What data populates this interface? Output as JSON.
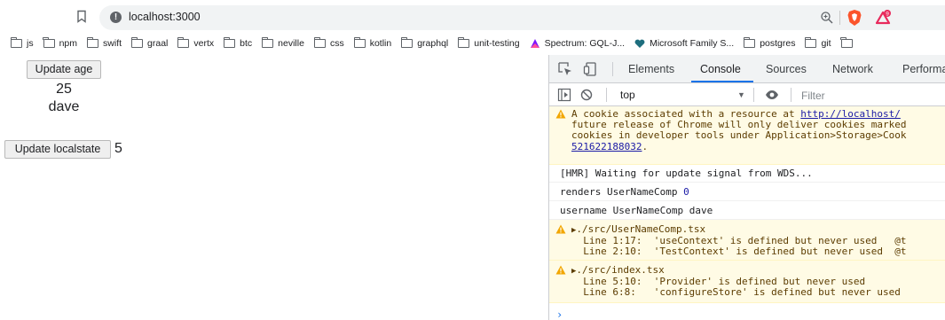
{
  "browser": {
    "url": "localhost:3000",
    "bookmarks": [
      {
        "label": "js",
        "icon": "folder-icon"
      },
      {
        "label": "npm",
        "icon": "folder-icon"
      },
      {
        "label": "swift",
        "icon": "folder-icon"
      },
      {
        "label": "graal",
        "icon": "folder-icon"
      },
      {
        "label": "vertx",
        "icon": "folder-icon"
      },
      {
        "label": "btc",
        "icon": "folder-icon"
      },
      {
        "label": "neville",
        "icon": "folder-icon"
      },
      {
        "label": "css",
        "icon": "folder-icon"
      },
      {
        "label": "kotlin",
        "icon": "folder-icon"
      },
      {
        "label": "graphql",
        "icon": "folder-icon"
      },
      {
        "label": "unit-testing",
        "icon": "folder-icon"
      },
      {
        "label": "Spectrum: GQL-J...",
        "icon": "spectrum-icon"
      },
      {
        "label": "Microsoft Family S...",
        "icon": "heart-icon"
      },
      {
        "label": "postgres",
        "icon": "folder-icon"
      },
      {
        "label": "git",
        "icon": "folder-icon"
      },
      {
        "label": "",
        "icon": "folder-icon"
      }
    ]
  },
  "app": {
    "update_age_label": "Update age",
    "age": "25",
    "name": "dave",
    "update_localstate_label": "Update localstate",
    "localstate": "5"
  },
  "devtools": {
    "tabs": [
      "Elements",
      "Console",
      "Sources",
      "Network",
      "Performa"
    ],
    "active_tab": "Console",
    "context": "top",
    "filter_placeholder": "Filter",
    "messages": {
      "cookie_line1a": "A cookie associated with a resource at ",
      "cookie_link": "http://localhost/",
      "cookie_line2": "future release of Chrome will only deliver cookies marked",
      "cookie_line3": "cookies in developer tools under Application>Storage>Cook",
      "cookie_line4": "521622188032",
      "cookie_line4_end": ".",
      "hmr": "[HMR] Waiting for update signal from WDS...",
      "renders_text": "renders UserNameComp ",
      "renders_count": "0",
      "username": "username UserNameComp dave",
      "warn1_file": "./src/UserNameComp.tsx",
      "warn1_line1": "Line 1:17:  'useContext' is defined but never used   @t",
      "warn1_line2": "Line 2:10:  'TestContext' is defined but never used  @t",
      "warn2_file": "./src/index.tsx",
      "warn2_line1": "Line 5:10:  'Provider' is defined but never used",
      "warn2_line2": "Line 6:8:   'configureStore' is defined but never used"
    },
    "prompt": "›"
  },
  "colors": {
    "accent": "#1a73e8",
    "warning_bg": "#fffbe5",
    "warning_icon": "#f2a600",
    "brave": "#fb542b"
  }
}
